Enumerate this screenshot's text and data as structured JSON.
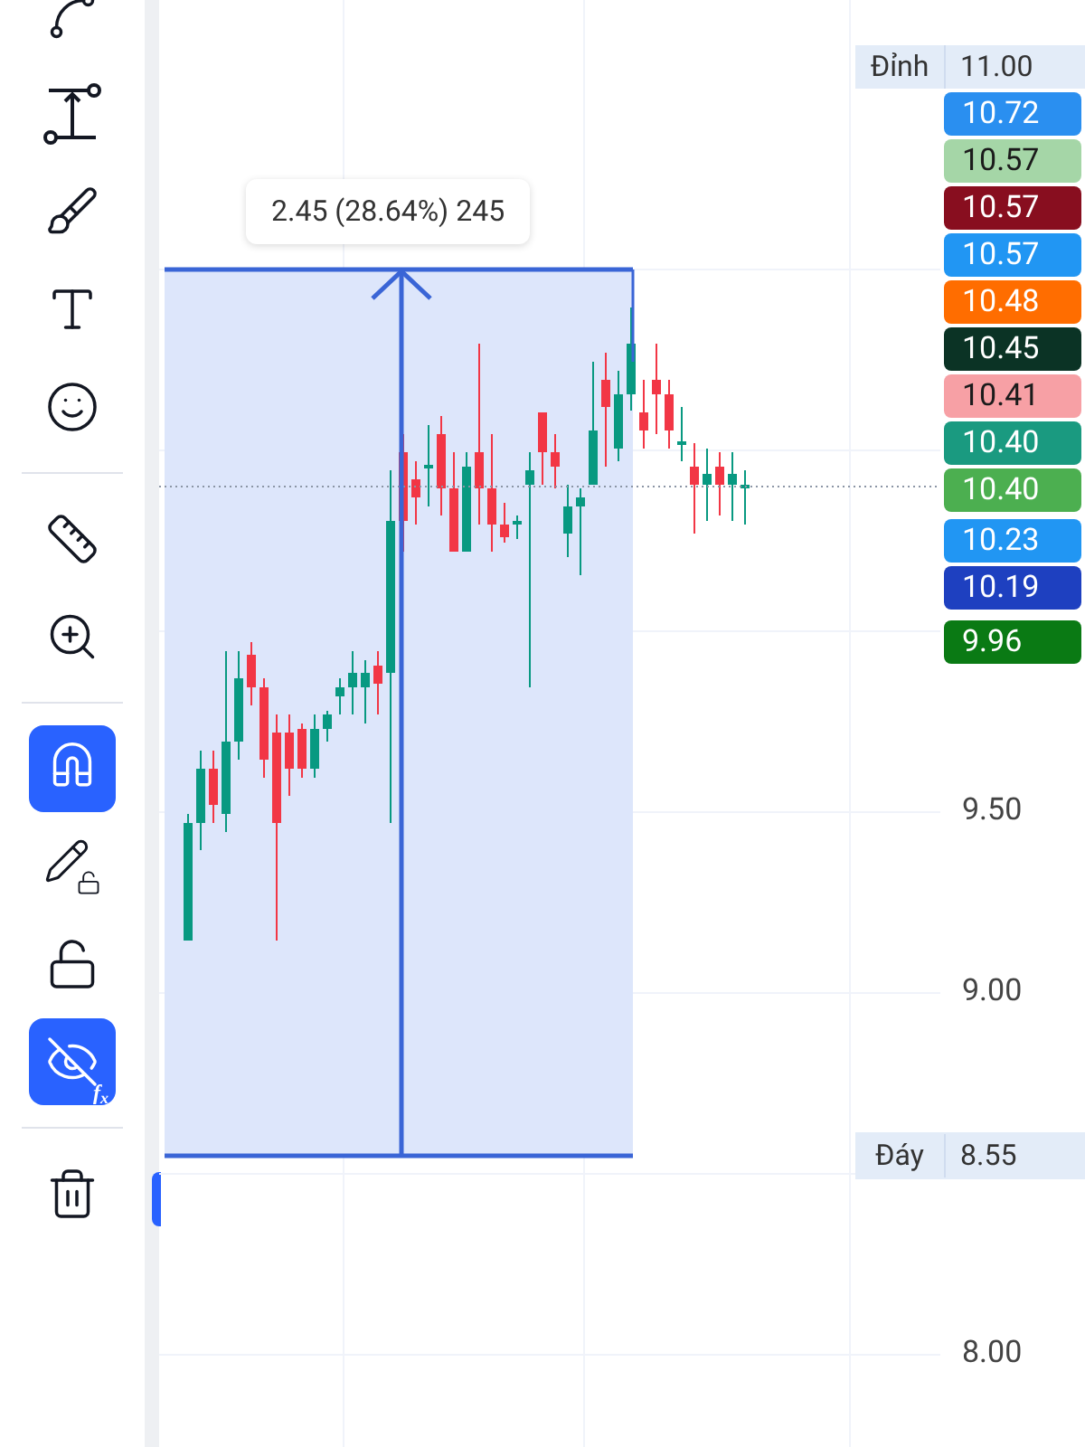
{
  "toolbar": {
    "groups": [
      {
        "tools": [
          {
            "selected": false
          },
          {
            "selected": false
          },
          {
            "selected": false
          },
          {
            "selected": false
          },
          {
            "selected": false
          }
        ]
      },
      {
        "tools": [
          {
            "selected": false
          },
          {
            "selected": false
          }
        ]
      },
      {
        "tools": [
          {
            "selected": true
          },
          {
            "selected": false
          },
          {
            "selected": false
          },
          {
            "selected": true,
            "badge": "f$_{x}$"
          }
        ]
      },
      {
        "tools": [
          {
            "selected": false
          }
        ]
      }
    ]
  },
  "measurement": {
    "label": "2.45 (28.64%) 245"
  },
  "high_marker": {
    "label": "Đỉnh",
    "price": "11.00"
  },
  "price_labels": [
    {
      "price": "10.72",
      "color": "#2a8ff0"
    },
    {
      "price": "10.57",
      "color": "#a5d6a7"
    },
    {
      "price": "10.57",
      "color": "#880e1f"
    },
    {
      "price": "10.57",
      "color": "#2196f3"
    },
    {
      "price": "10.48",
      "color": "#ff6d00"
    },
    {
      "price": "10.45",
      "color": "#0b3325"
    },
    {
      "price": "10.41",
      "color": "#f7a0a5"
    },
    {
      "price": "10.40",
      "color": "#1a9a80"
    },
    {
      "price": "10.40",
      "color": "#4caf50"
    },
    {
      "price": "10.23",
      "color": "#2196f3"
    },
    {
      "price": "10.19",
      "color": "#1e40c0"
    },
    {
      "price": "9.96",
      "color": "#0a7a14"
    }
  ],
  "price_axis": {
    "ticks": [
      "9.50",
      "9.00",
      "8.00"
    ]
  },
  "low_marker": {
    "label": "Đáy",
    "price": "8.55"
  }
}
